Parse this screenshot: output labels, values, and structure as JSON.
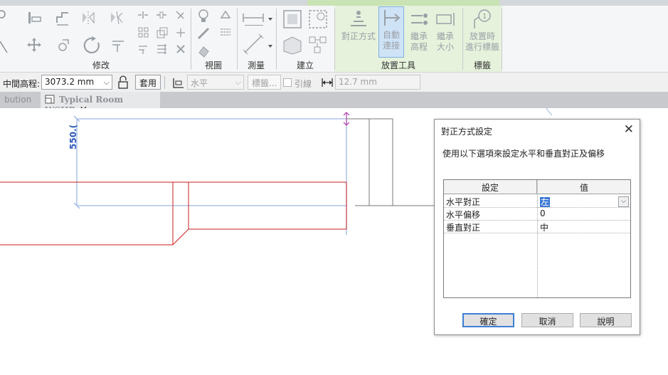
{
  "ribbon": {
    "panels": {
      "modify": "修改",
      "view": "視圖",
      "measure": "測量",
      "create": "建立",
      "placement_tools": "放置工具",
      "tag": "標籤"
    },
    "buttons": {
      "justification": "對正方式",
      "auto_connect_1": "自動",
      "auto_connect_2": "連接",
      "inherit_elev_1": "繼承",
      "inherit_elev_2": "高程",
      "inherit_size_1": "繼承",
      "inherit_size_2": "大小",
      "tag_on_place_1": "放置時",
      "tag_on_place_2": "進行標籤"
    }
  },
  "optionsbar": {
    "middle_elevation_label": "中間高程:",
    "middle_elevation_value": "3073.2 mm",
    "apply_label": "套用",
    "orientation_value": "水平",
    "tag_type_value": "標籤...",
    "leader_label": "引線",
    "leader_length_value": "12.7 mm"
  },
  "viewtabs": {
    "prev_tab": "bution",
    "active_tab": "Typical Room WSHP"
  },
  "canvas": {
    "dimension_text": "550.("
  },
  "dialog": {
    "title": "對正方式設定",
    "description": "使用以下選項來設定水平和垂直對正及偏移",
    "grid": {
      "col_setting": "設定",
      "col_value": "值",
      "rows": [
        {
          "setting": "水平對正",
          "value": "左"
        },
        {
          "setting": "水平偏移",
          "value": "0"
        },
        {
          "setting": "垂直對正",
          "value": "中"
        }
      ]
    },
    "ok": "確定",
    "cancel": "取消",
    "help": "說明"
  },
  "colors": {
    "accent_blue": "#3c7fd6",
    "context_tab_green": "#e6f2dc",
    "duct_red": "#cc1f1f",
    "dimension_blue": "#2d57b9"
  },
  "icons": [
    "align-icon",
    "move-icon",
    "copy-icon",
    "rotate-icon",
    "mirror-icon",
    "trim-icon",
    "delete-icon",
    "bulb-icon",
    "measure-icon",
    "create-group-icon",
    "justification-icon",
    "auto-connect-icon",
    "inherit-elevation-icon",
    "inherit-size-icon",
    "tag-on-placement-icon",
    "lock-icon",
    "leader-icon",
    "close-icon",
    "dropdown-chevron-icon"
  ]
}
